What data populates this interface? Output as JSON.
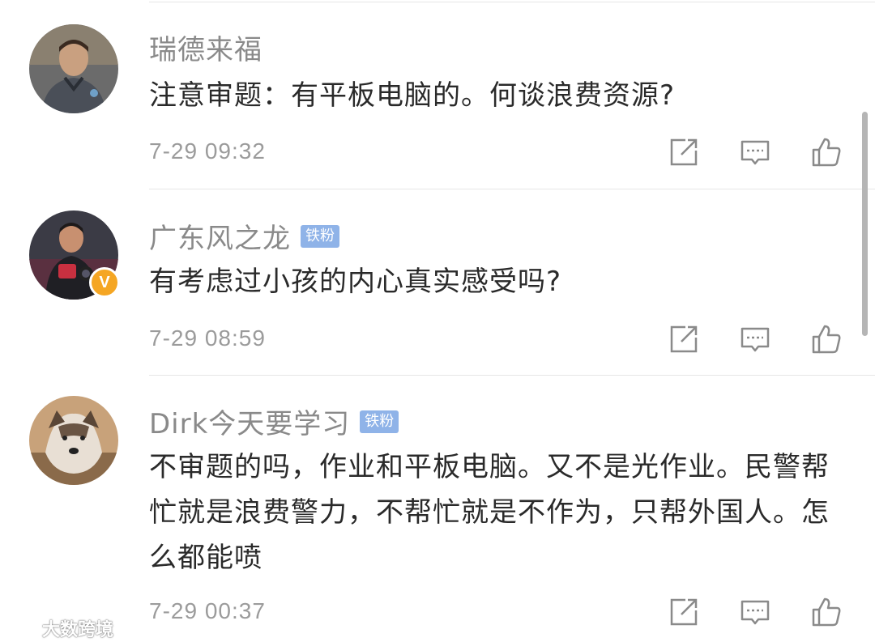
{
  "comments": [
    {
      "username": "瑞德来福",
      "badge": "",
      "verified": false,
      "text": "注意审题：有平板电脑的。何谈浪费资源?",
      "time": "7-29 09:32"
    },
    {
      "username": "广东风之龙",
      "badge": "铁粉",
      "verified": true,
      "verified_mark": "V",
      "text": "有考虑过小孩的内心真实感受吗?",
      "time": "7-29 08:59"
    },
    {
      "username": "Dirk今天要学习",
      "badge": "铁粉",
      "verified": false,
      "text": "不审题的吗，作业和平板电脑。又不是光作业。民警帮忙就是浪费警力，不帮忙就是不作为，只帮外国人。怎么都能喷",
      "time": "7-29 00:37"
    }
  ],
  "icons": [
    "share-icon",
    "comment-icon",
    "like-icon"
  ],
  "watermark": {
    "text": "大数跨境",
    "logo": "weibo-logo"
  },
  "colors": {
    "name": "#8a8a8a",
    "text": "#2a2a2a",
    "time": "#9b9b9b",
    "badge": "#8fb3e8",
    "verified": "#f5a623"
  }
}
